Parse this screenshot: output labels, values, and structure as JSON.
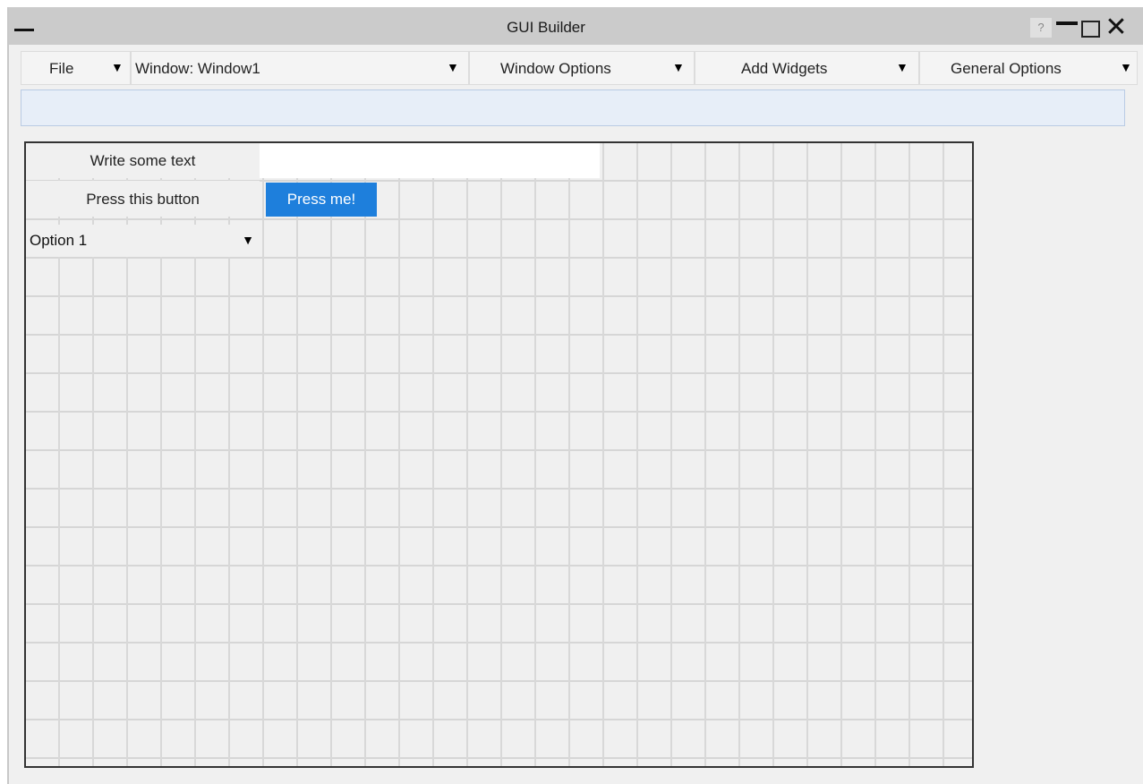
{
  "window": {
    "title": "GUI Builder",
    "help_label": "?",
    "close_glyph": "✕"
  },
  "toolbar": {
    "file_label": "File",
    "window_select_label": "Window: Window1",
    "window_options_label": "Window Options",
    "add_widgets_label": "Add Widgets",
    "general_options_label": "General Options",
    "arrow_glyph": "▼"
  },
  "message_bar": {
    "text": ""
  },
  "canvas": {
    "text_label": "Write some text",
    "text_value": "",
    "button_label": "Press this button",
    "button_text": "Press me!",
    "combo_value": "Option 1"
  },
  "icons": {
    "window_menu": "menu-dash-icon",
    "help": "help-icon",
    "minimize": "minimize-icon",
    "maximize": "maximize-icon",
    "close": "close-icon",
    "dropdown": "chevron-down-icon"
  },
  "colors": {
    "titlebar": "#cbcbcb",
    "background": "#f0f0f0",
    "accent_button": "#1e7fdc",
    "message_bar": "#e7eef8"
  }
}
